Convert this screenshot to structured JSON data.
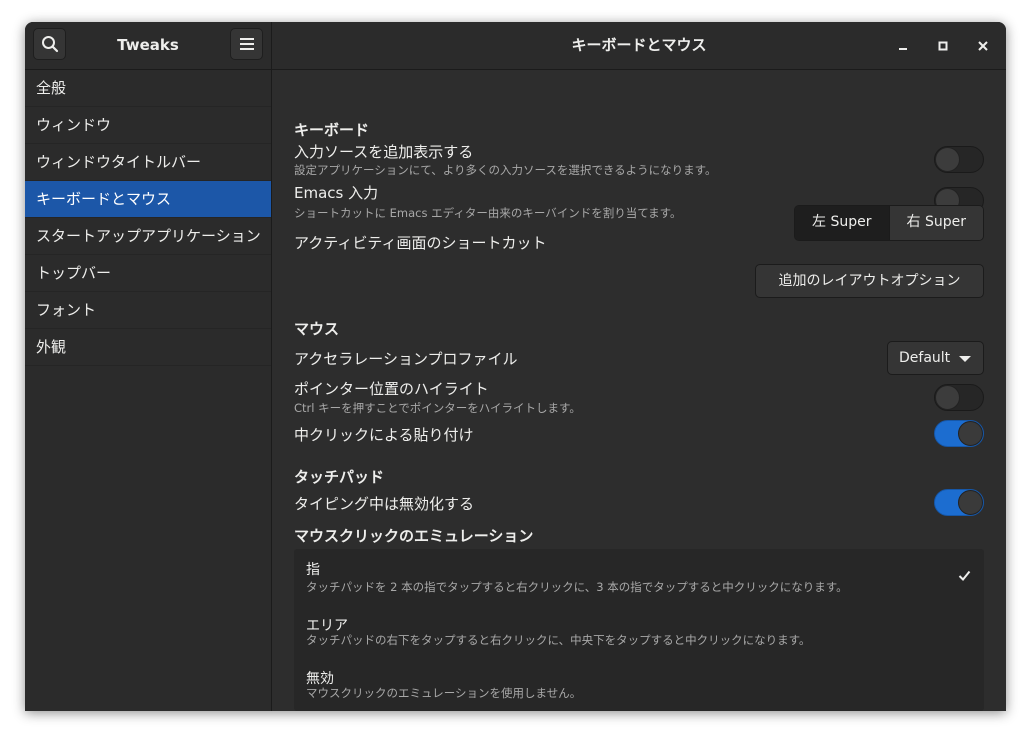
{
  "header": {
    "sidebar_title": "Tweaks",
    "main_title": "キーボードとマウス"
  },
  "sidebar": {
    "items": [
      {
        "label": "全般"
      },
      {
        "label": "ウィンドウ"
      },
      {
        "label": "ウィンドウタイトルバー"
      },
      {
        "label": "キーボードとマウス",
        "active": true
      },
      {
        "label": "スタートアップアプリケーション"
      },
      {
        "label": "トップバー"
      },
      {
        "label": "フォント"
      },
      {
        "label": "外観"
      }
    ]
  },
  "keyboard": {
    "section": "キーボード",
    "input_sources": {
      "label": "入力ソースを追加表示する",
      "desc": "設定アプリケーションにて、より多くの入力ソースを選択できるようになります。",
      "enabled": false
    },
    "emacs": {
      "label": "Emacs 入力",
      "desc": "ショートカットに Emacs エディター由来のキーバインドを割り当てます。",
      "enabled": false
    },
    "overview_shortcut": {
      "label": "アクティビティ画面のショートカット",
      "left": "左 Super",
      "right": "右 Super",
      "selected": "left"
    },
    "layout_button": "追加のレイアウトオプション"
  },
  "mouse": {
    "section": "マウス",
    "accel": {
      "label": "アクセラレーションプロファイル",
      "value": "Default"
    },
    "pointer_highlight": {
      "label": "ポインター位置のハイライト",
      "desc": "Ctrl キーを押すことでポインターをハイライトします。",
      "enabled": false
    },
    "middle_paste": {
      "label": "中クリックによる貼り付け",
      "enabled": true
    }
  },
  "touchpad": {
    "section": "タッチパッド",
    "disable_typing": {
      "label": "タイピング中は無効化する",
      "enabled": true
    }
  },
  "emulation": {
    "section": "マウスクリックのエミュレーション",
    "options": [
      {
        "title": "指",
        "desc": "タッチパッドを 2 本の指でタップすると右クリックに、3 本の指でタップすると中クリックになります。",
        "selected": true
      },
      {
        "title": "エリア",
        "desc": "タッチパッドの右下をタップすると右クリックに、中央下をタップすると中クリックになります。",
        "selected": false
      },
      {
        "title": "無効",
        "desc": "マウスクリックのエミュレーションを使用しません。",
        "selected": false
      }
    ]
  }
}
